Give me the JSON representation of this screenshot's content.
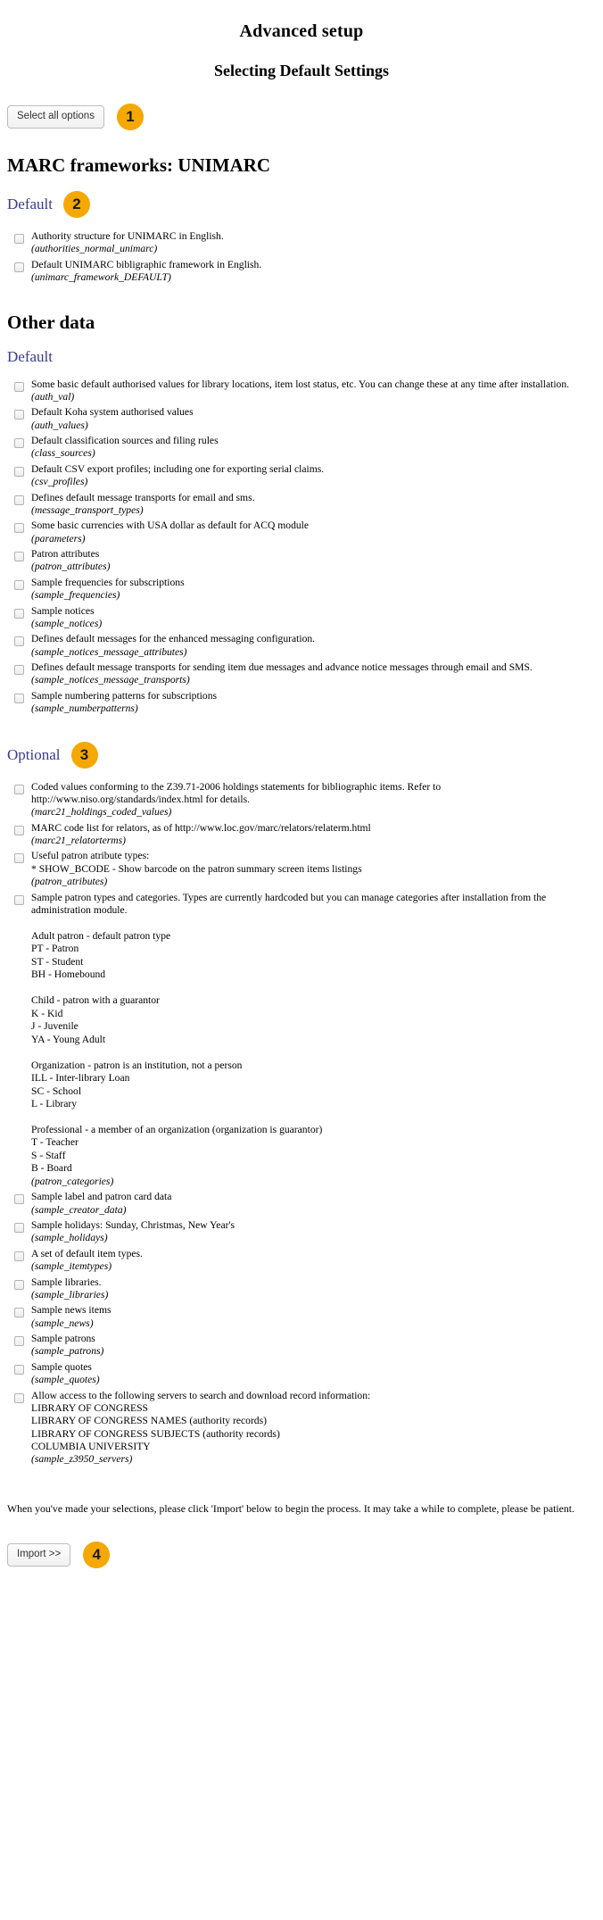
{
  "page": {
    "title": "Advanced setup",
    "subtitle": "Selecting Default Settings"
  },
  "toolbar": {
    "select_all_label": "Select all options",
    "callout_1": "1"
  },
  "marc_section": {
    "heading": "MARC frameworks: UNIMARC",
    "group_label": "Default",
    "callout_2": "2",
    "items": [
      {
        "desc": "Authority structure for UNIMARC in English.",
        "code": "(authorities_normal_unimarc)",
        "detail": ""
      },
      {
        "desc": "Default UNIMARC bibligraphic framework in English.",
        "code": "(unimarc_framework_DEFAULT)",
        "detail": ""
      }
    ]
  },
  "other_section": {
    "heading": "Other data",
    "default_group": {
      "label": "Default",
      "items": [
        {
          "desc": "Some basic default authorised values for library locations, item lost status, etc. You can change these at any time after installation.",
          "code": "(auth_val)",
          "detail": ""
        },
        {
          "desc": "Default Koha system authorised values",
          "code": "(auth_values)",
          "detail": ""
        },
        {
          "desc": "Default classification sources and filing rules",
          "code": "(class_sources)",
          "detail": ""
        },
        {
          "desc": "Default CSV export profiles; including one for exporting serial claims.",
          "code": "(csv_profiles)",
          "detail": ""
        },
        {
          "desc": "Defines default message transports for email and sms.",
          "code": "(message_transport_types)",
          "detail": ""
        },
        {
          "desc": "Some basic currencies with USA dollar as default for ACQ module",
          "code": "(parameters)",
          "detail": ""
        },
        {
          "desc": "Patron attributes",
          "code": "(patron_attributes)",
          "detail": ""
        },
        {
          "desc": "Sample frequencies for subscriptions",
          "code": "(sample_frequencies)",
          "detail": ""
        },
        {
          "desc": "Sample notices",
          "code": "(sample_notices)",
          "detail": ""
        },
        {
          "desc": "Defines default messages for the enhanced messaging configuration.",
          "code": "(sample_notices_message_attributes)",
          "detail": ""
        },
        {
          "desc": "Defines default message transports for sending item due messages and advance notice messages through email and SMS.",
          "code": "(sample_notices_message_transports)",
          "detail": ""
        },
        {
          "desc": "Sample numbering patterns for subscriptions",
          "code": "(sample_numberpatterns)",
          "detail": ""
        }
      ]
    },
    "optional_group": {
      "label": "Optional",
      "callout_3": "3",
      "items": [
        {
          "desc": "Coded values conforming to the Z39.71-2006 holdings statements for bibliographic items. Refer to http://www.niso.org/standards/index.html for details.",
          "code": "(marc21_holdings_coded_values)",
          "detail": ""
        },
        {
          "desc": "MARC code list for relators, as of http://www.loc.gov/marc/relators/relaterm.html",
          "code": "(marc21_relatorterms)",
          "detail": ""
        },
        {
          "desc": "Useful patron atribute types:\n* SHOW_BCODE - Show barcode on the patron summary screen items listings",
          "code": "(patron_atributes)",
          "detail": ""
        },
        {
          "desc": "Sample patron types and categories. Types are currently hardcoded but you can manage categories after installation from the administration module.",
          "code": "(patron_categories)",
          "detail": "\nAdult patron - default patron type\nPT - Patron\nST - Student\nBH - Homebound\n\nChild - patron with a guarantor\nK - Kid\nJ - Juvenile\nYA - Young Adult\n\nOrganization - patron is an institution, not a person\nILL - Inter-library Loan\nSC - School\nL - Library\n\nProfessional - a member of an organization (organization is guarantor)\nT - Teacher\nS - Staff\nB - Board"
        },
        {
          "desc": "Sample label and patron card data",
          "code": "(sample_creator_data)",
          "detail": ""
        },
        {
          "desc": "Sample holidays: Sunday, Christmas, New Year's",
          "code": "(sample_holidays)",
          "detail": ""
        },
        {
          "desc": "A set of default item types.",
          "code": "(sample_itemtypes)",
          "detail": ""
        },
        {
          "desc": "Sample libraries.",
          "code": "(sample_libraries)",
          "detail": ""
        },
        {
          "desc": "Sample news items",
          "code": "(sample_news)",
          "detail": ""
        },
        {
          "desc": "Sample patrons",
          "code": "(sample_patrons)",
          "detail": ""
        },
        {
          "desc": "Sample quotes",
          "code": "(sample_quotes)",
          "detail": ""
        },
        {
          "desc": "Allow access to the following servers to search and download record information:\nLIBRARY OF CONGRESS\nLIBRARY OF CONGRESS NAMES (authority records)\nLIBRARY OF CONGRESS SUBJECTS (authority records)\nCOLUMBIA UNIVERSITY",
          "code": "(sample_z3950_servers)",
          "detail": ""
        }
      ]
    }
  },
  "footer": {
    "note": "When you've made your selections, please click 'Import' below to begin the process. It may take a while to complete, please be patient.",
    "import_label": "Import >>",
    "callout_4": "4"
  },
  "colors": {
    "callout_bg": "#f5a800",
    "group_label": "#3a3a8c"
  }
}
